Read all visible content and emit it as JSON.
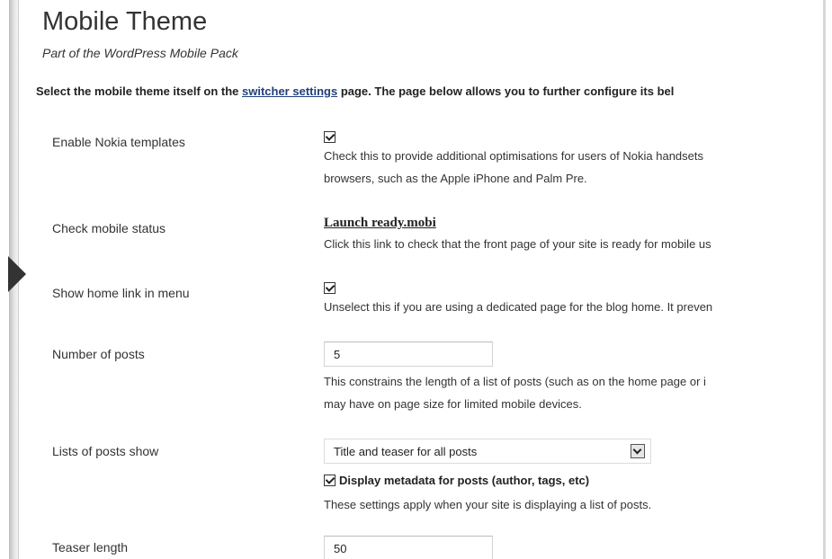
{
  "header": {
    "title": "Mobile Theme",
    "subtitle": "Part of the WordPress Mobile Pack"
  },
  "intro": {
    "before_link": "Select the mobile theme itself on the ",
    "link_text": "switcher settings",
    "after_link": " page. The page below allows you to further configure its bel"
  },
  "settings": {
    "nokia": {
      "label": "Enable Nokia templates",
      "checked": true,
      "desc_line1": "Check this to provide additional optimisations for users of Nokia handsets",
      "desc_line2": "browsers, such as the Apple iPhone and Palm Pre."
    },
    "mobile_status": {
      "label": "Check mobile status",
      "link_text": "Launch ready.mobi",
      "desc": "Click this link to check that the front page of your site is ready for mobile us"
    },
    "home_link": {
      "label": "Show home link in menu",
      "checked": true,
      "desc": "Unselect this if you are using a dedicated page for the blog home. It preven"
    },
    "num_posts": {
      "label": "Number of posts",
      "value": "5",
      "desc_line1": "This constrains the length of a list of posts (such as on the home page or i",
      "desc_line2": "may have on page size for limited mobile devices."
    },
    "list_show": {
      "label": "Lists of posts show",
      "selected": "Title and teaser for all posts",
      "metadata_label": "Display metadata for posts (author, tags, etc)",
      "metadata_checked": true,
      "desc": "These settings apply when your site is displaying a list of posts."
    },
    "teaser_length": {
      "label": "Teaser length",
      "value": "50"
    }
  }
}
